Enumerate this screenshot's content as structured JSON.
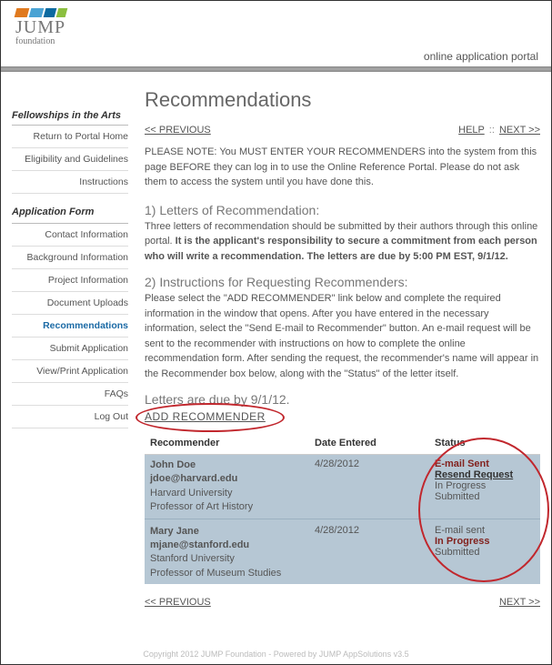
{
  "header": {
    "logo_top": "JUMP",
    "logo_sub": "foundation",
    "portal_label": "online application portal"
  },
  "sidebar": {
    "group1_title": "Fellowships in the Arts",
    "group1_items": [
      {
        "label": "Return to Portal Home"
      },
      {
        "label": "Eligibility and Guidelines"
      },
      {
        "label": "Instructions"
      }
    ],
    "group2_title": "Application Form",
    "group2_items": [
      {
        "label": "Contact Information"
      },
      {
        "label": "Background Information"
      },
      {
        "label": "Project Information"
      },
      {
        "label": "Document Uploads"
      },
      {
        "label": "Recommendations",
        "active": true
      },
      {
        "label": "Submit Application"
      },
      {
        "label": "View/Print Application"
      },
      {
        "label": "FAQs"
      },
      {
        "label": "Log Out"
      }
    ]
  },
  "main": {
    "title": "Recommendations",
    "prev_label": "<< PREVIOUS",
    "help_label": "HELP",
    "colons": "::",
    "next_label": "NEXT >>",
    "note_lead": "PLEASE NOTE: You MUST ENTER YOUR RECOMMENDERS ",
    "note_rest": "into the system from this page BEFORE they can log in to use the Online Reference Portal. Please do not ask them to access the system until you have done this.",
    "sec1_title": "1) Letters of Recommendation:",
    "sec1_lead": "Three letters of recommendation should be submitted by their authors through this online portal. ",
    "sec1_bold": "It is the applicant's responsibility to secure a commitment from each person who will write a recommendation. The letters are due by 5:00 PM EST, 9/1/12.",
    "sec2_title": "2) Instructions for Requesting Recommenders:",
    "sec2_text": "Please select the \"ADD RECOMMENDER\" link below and complete the required information in the window that opens. After you have entered in the necessary information, select the \"Send E-mail to Recommender\" button. An e-mail request will be sent to the recommender with instructions on how to complete the online recommendation form. After sending the request, the recommender's name will appear in the Recommender box below, along with the \"Status\" of the letter itself.",
    "letters_due": "Letters are due by 9/1/12.",
    "add_link": "ADD RECOMMENDER",
    "table": {
      "col_recommender": "Recommender",
      "col_date": "Date Entered",
      "col_status": "Status",
      "rows": [
        {
          "name": "John Doe",
          "email": "jdoe@harvard.edu",
          "inst": "Harvard University",
          "title": "Professor of Art History",
          "date": "4/28/2012",
          "s1": "E-mail Sent",
          "s1_emph": true,
          "s2": "Resend Request",
          "s2_link": true,
          "s3": "In Progress",
          "s4": "Submitted"
        },
        {
          "name": "Mary Jane",
          "email": "mjane@stanford.edu",
          "inst": "Stanford University",
          "title": "Professor of Museum Studies",
          "date": "4/28/2012",
          "s1": "E-mail sent",
          "s2": "In Progress",
          "s2_emph": true,
          "s3": "Submitted"
        }
      ]
    }
  },
  "footer": {
    "text": "Copyright 2012 JUMP Foundation - Powered by JUMP AppSolutions v3.5"
  }
}
